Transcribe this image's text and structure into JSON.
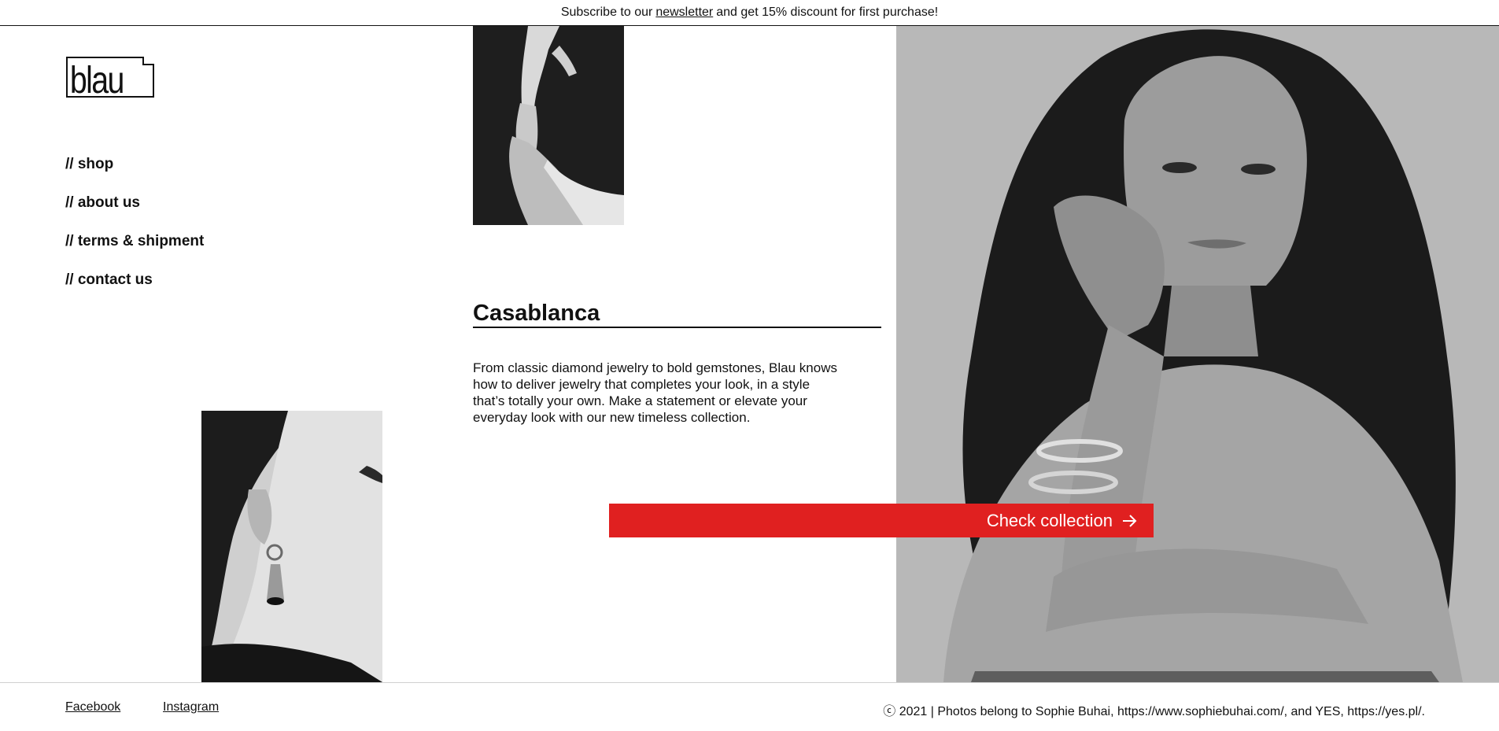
{
  "announcement": {
    "prefix": "Subscribe to our",
    "link": "newsletter",
    "suffix": "and get 15% discount for first purchase!"
  },
  "logo": {
    "text": "blau"
  },
  "nav": {
    "items": [
      {
        "label": "// shop"
      },
      {
        "label": "// about us"
      },
      {
        "label": "// terms & shipment"
      },
      {
        "label": "// contact us"
      }
    ]
  },
  "collection": {
    "title": "Casablanca",
    "description": "From classic diamond jewelry to bold gemstones, Blau knows how to deliver jewelry that completes your look, in a style that’s totally your own. Make a statement or elevate your everyday look with our new timeless collection.",
    "cta_label": "Check collection"
  },
  "footer": {
    "facebook": "Facebook",
    "instagram": "Instagram",
    "credit": "ⓒ 2021 | Photos belong to Sophie Buhai, https://www.sophiebuhai.com/, and YES, https://yes.pl/."
  },
  "colors": {
    "accent": "#e02020",
    "text": "#111111",
    "background": "#ffffff"
  },
  "icons": {
    "cta_arrow": "arrow-right-icon"
  }
}
